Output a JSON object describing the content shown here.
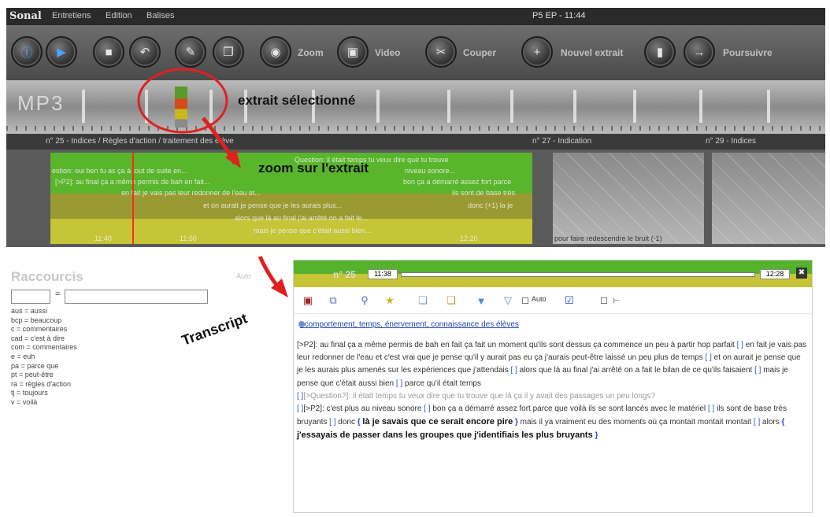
{
  "titlebar": {
    "app_name": "Sonal",
    "menu": [
      "Entretiens",
      "Edition",
      "Balises"
    ],
    "window_title": "P5 EP - 11:44"
  },
  "toolbar": {
    "buttons": [
      {
        "name": "info-button",
        "glyph": "Ⓘ"
      },
      {
        "name": "play-button",
        "glyph": "▶"
      },
      {
        "name": "stop-button",
        "glyph": "■"
      },
      {
        "name": "undo-button",
        "glyph": "↶"
      },
      {
        "name": "edit-button",
        "glyph": "✎"
      },
      {
        "name": "document-button",
        "glyph": "❐"
      },
      {
        "name": "zoom-button",
        "glyph": "◉"
      },
      {
        "name": "video-button",
        "glyph": "▣"
      },
      {
        "name": "cut-button",
        "glyph": "✂"
      },
      {
        "name": "new-extract-button",
        "glyph": "+"
      },
      {
        "name": "marker-button",
        "glyph": "▮"
      },
      {
        "name": "continue-button",
        "glyph": "→"
      }
    ],
    "label_zoom": "Zoom",
    "label_video": "Video",
    "label_cut": "Couper",
    "label_new_extract": "Nouvel extrait",
    "label_continue": "Poursuivre"
  },
  "timeline": {
    "logo_text": "MP3"
  },
  "segment_header": {
    "seg1": "n° 25 - Indices / Règles d'action / traitement des élève",
    "seg2": "n° 27 - Indication",
    "seg3": "n° 29 - Indices"
  },
  "zoom": {
    "lines_green": [
      "Question: il était temps tu veux dire que tu trouve",
      "estion: oui ben tu as ça à tout de suite en...",
      "[>P2]: au final ça a même permis de bah en fait...",
      "en fait je vais pas leur redonner de l'eau et...",
      "et on aurait je pense que je les aurais plus...",
      "alors que là au final j'ai arrêté on a fait le...",
      "mais je pense que c'était aussi bien...",
      "bon ça a démarré assez fort parce",
      "ils sont de base très",
      "donc (+1) la je",
      "niveau sonore..."
    ],
    "time_11_40": "11:40",
    "time_11_50": "11:50",
    "time_12_20": "12:20",
    "gray_line": "pour faire redescendre le bruit (-1)"
  },
  "annotations": {
    "selected_extract": "extrait sélectionné",
    "zoom_extract": "zoom sur l'extrait",
    "transcript": "Transcript"
  },
  "shortcuts": {
    "title": "Raccourcis",
    "auto_label": "Auto",
    "equals": "=",
    "items": [
      "aus = aussi",
      "bcp = beaucoup",
      "c = commentaires",
      "cad = c'est à dire",
      "com = commentaires",
      "e = euh",
      "pa = parce que",
      "pt = peut-être",
      "ra = règles d'action",
      "tj = toujours",
      "v = voilà"
    ]
  },
  "transcript": {
    "number": "n° 25",
    "start_time": "11:38",
    "end_time": "12:28",
    "close_icon": "✖",
    "auto_label": "Auto",
    "tags": "comportement, temps, énervement, connaissance des élèves",
    "p1": "[>P2]: au final ça a même permis de bah en fait ça fait un moment qu'ils sont dessus ça commence un peu à partir hop parfait",
    "p1b": "en fait je vais pas leur redonner de l'eau et c'est vrai que je pense qu'il y aurait pas eu ça j'aurais peut-être laissé un peu plus de temps",
    "p1c": "et on aurait je pense que je les aurais plus amenés sur les expériences que j'attendais",
    "p1d": "alors que là au final j'ai arrêté on a fait le bilan de ce qu'ils faisaient",
    "p1e": "mais je pense que c'était aussi bien",
    "p1f": "parce qu'il était temps",
    "q1": "[>Question?]: il était temps tu veux dire que tu trouve que là ça il y avait des passages un peu longs?",
    "p2": "[>P2]: c'est plus au niveau sonore",
    "p2b": "bon ça a démarré assez fort parce que voilà ils se sont lancés avec le matériel",
    "p2c": "ils sont de base très bruyants",
    "p2d": "donc",
    "p2e": "là je savais que ce serait encore pire",
    "p2f": "mais il ya vraiment eu des moments où ça montait montait montait",
    "p2g": "alors",
    "p2h": "j'essayais de passer dans les groupes que j'identifiais les plus bruyants"
  },
  "colors": {
    "green": "#59b52c",
    "yellow": "#c6c437",
    "red_annotation": "#e02020"
  }
}
